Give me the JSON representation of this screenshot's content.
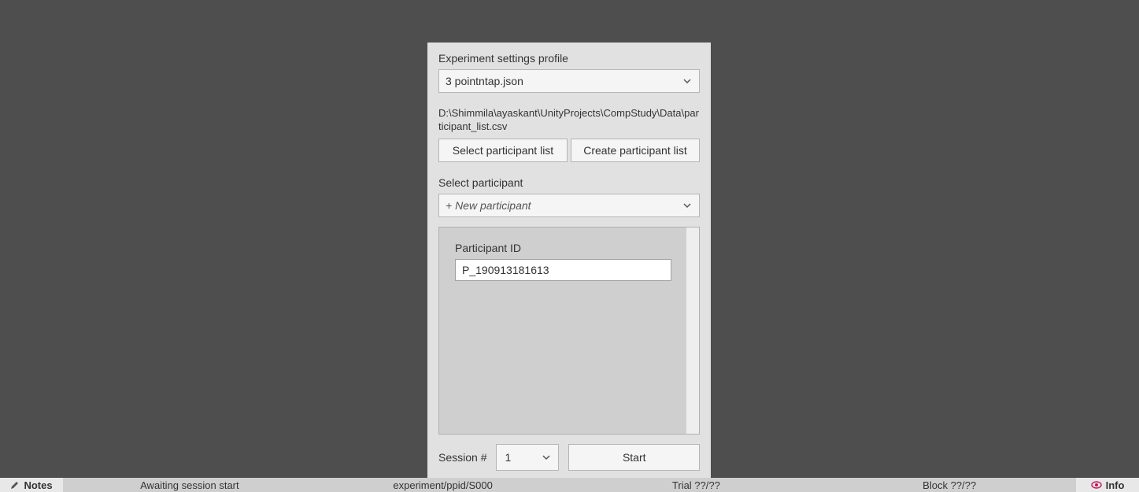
{
  "panel": {
    "profile_label": "Experiment settings profile",
    "profile_selected": "3 pointntap.json",
    "participant_list_path": "D:\\Shimmila\\ayaskant\\UnityProjects\\CompStudy\\Data\\participant_list.csv",
    "select_list_btn": "Select participant list",
    "create_list_btn": "Create participant list",
    "select_participant_label": "Select participant",
    "participant_placeholder": "+ New participant",
    "participant_id_label": "Participant ID",
    "participant_id_value": "P_190913181613",
    "session_label": "Session #",
    "session_value": "1",
    "start_label": "Start"
  },
  "statusbar": {
    "notes_label": "Notes",
    "awaiting": "Awaiting session start",
    "experiment": "experiment/ppid/S000",
    "trial": "Trial ??/??",
    "block": "Block ??/??",
    "info_label": "Info"
  }
}
